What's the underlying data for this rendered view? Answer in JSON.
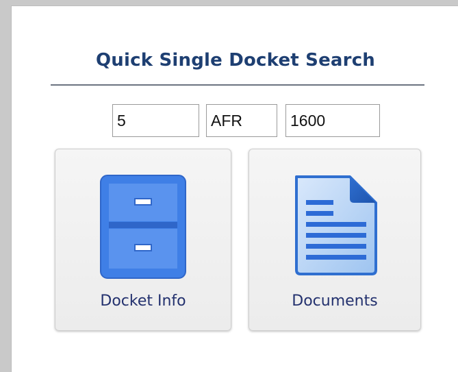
{
  "search": {
    "title": "Quick Single Docket Search",
    "fields": [
      {
        "value": "5"
      },
      {
        "value": "AFR"
      },
      {
        "value": "1600"
      }
    ]
  },
  "actions": [
    {
      "label": "Docket Info",
      "icon": "filing-cabinet-icon"
    },
    {
      "label": "Documents",
      "icon": "document-icon"
    }
  ],
  "colors": {
    "title": "#1e3f72",
    "label": "#23316e",
    "icon_blue": "#4a86e8"
  }
}
